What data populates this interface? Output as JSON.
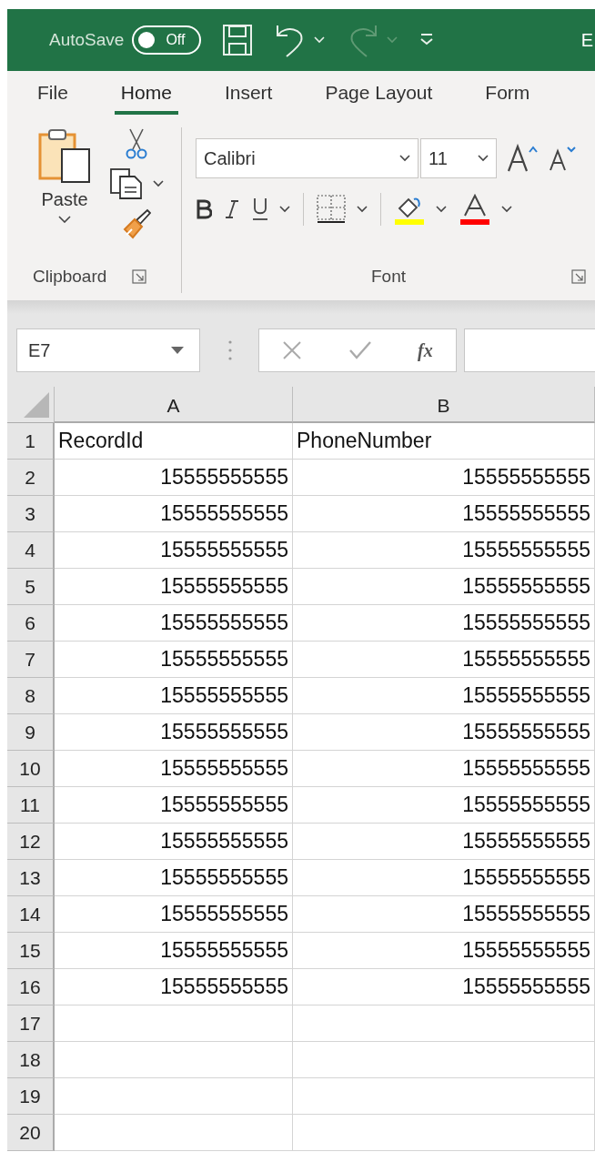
{
  "title_bar": {
    "autosave": {
      "label": "AutoSave",
      "on": false,
      "state_text": "Off"
    },
    "title": "E"
  },
  "tabs": [
    {
      "label": "File",
      "selected": false
    },
    {
      "label": "Home",
      "selected": true
    },
    {
      "label": "Insert",
      "selected": false
    },
    {
      "label": "Page Layout",
      "selected": false
    },
    {
      "label": "Form",
      "selected": false
    }
  ],
  "ribbon": {
    "groups": [
      {
        "kind": "clipboard",
        "label": "Clipboard",
        "paste_label": "Paste"
      },
      {
        "kind": "font",
        "label": "Font",
        "font_name": "Calibri",
        "font_size": "11"
      }
    ]
  },
  "formula_bar": {
    "name_box": "E7",
    "function_button": "fx"
  },
  "sheet": {
    "columns": [
      "A",
      "B"
    ],
    "rows": [
      {
        "number": "1",
        "cells": [
          {
            "kind": "text",
            "value": "RecordId"
          },
          {
            "kind": "text",
            "value": "PhoneNumber"
          }
        ]
      },
      {
        "number": "2",
        "cells": [
          {
            "kind": "number",
            "value": "15555555555"
          },
          {
            "kind": "number",
            "value": "15555555555"
          }
        ]
      },
      {
        "number": "3",
        "cells": [
          {
            "kind": "number",
            "value": "15555555555"
          },
          {
            "kind": "number",
            "value": "15555555555"
          }
        ]
      },
      {
        "number": "4",
        "cells": [
          {
            "kind": "number",
            "value": "15555555555"
          },
          {
            "kind": "number",
            "value": "15555555555"
          }
        ]
      },
      {
        "number": "5",
        "cells": [
          {
            "kind": "number",
            "value": "15555555555"
          },
          {
            "kind": "number",
            "value": "15555555555"
          }
        ]
      },
      {
        "number": "6",
        "cells": [
          {
            "kind": "number",
            "value": "15555555555"
          },
          {
            "kind": "number",
            "value": "15555555555"
          }
        ]
      },
      {
        "number": "7",
        "cells": [
          {
            "kind": "number",
            "value": "15555555555"
          },
          {
            "kind": "number",
            "value": "15555555555"
          }
        ]
      },
      {
        "number": "8",
        "cells": [
          {
            "kind": "number",
            "value": "15555555555"
          },
          {
            "kind": "number",
            "value": "15555555555"
          }
        ]
      },
      {
        "number": "9",
        "cells": [
          {
            "kind": "number",
            "value": "15555555555"
          },
          {
            "kind": "number",
            "value": "15555555555"
          }
        ]
      },
      {
        "number": "10",
        "cells": [
          {
            "kind": "number",
            "value": "15555555555"
          },
          {
            "kind": "number",
            "value": "15555555555"
          }
        ]
      },
      {
        "number": "11",
        "cells": [
          {
            "kind": "number",
            "value": "15555555555"
          },
          {
            "kind": "number",
            "value": "15555555555"
          }
        ]
      },
      {
        "number": "12",
        "cells": [
          {
            "kind": "number",
            "value": "15555555555"
          },
          {
            "kind": "number",
            "value": "15555555555"
          }
        ]
      },
      {
        "number": "13",
        "cells": [
          {
            "kind": "number",
            "value": "15555555555"
          },
          {
            "kind": "number",
            "value": "15555555555"
          }
        ]
      },
      {
        "number": "14",
        "cells": [
          {
            "kind": "number",
            "value": "15555555555"
          },
          {
            "kind": "number",
            "value": "15555555555"
          }
        ]
      },
      {
        "number": "15",
        "cells": [
          {
            "kind": "number",
            "value": "15555555555"
          },
          {
            "kind": "number",
            "value": "15555555555"
          }
        ]
      },
      {
        "number": "16",
        "cells": [
          {
            "kind": "number",
            "value": "15555555555"
          },
          {
            "kind": "number",
            "value": "15555555555"
          }
        ]
      },
      {
        "number": "17"
      },
      {
        "number": "18"
      },
      {
        "number": "19"
      },
      {
        "number": "20"
      }
    ]
  }
}
